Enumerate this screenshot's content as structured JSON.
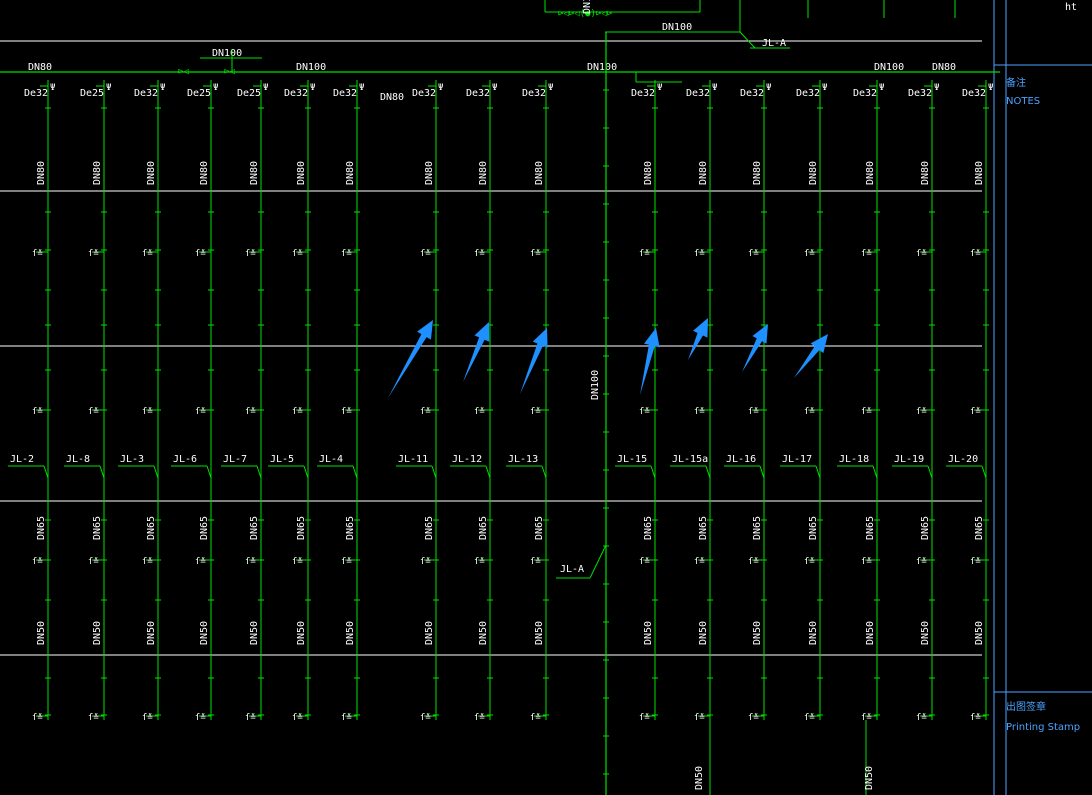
{
  "palette": {
    "background": "#000000",
    "pipe": "#00e000",
    "floor_line": "#ffffff",
    "label": "#ffffff",
    "notes_text": "#4aa3ff",
    "arrow": "#1e90ff"
  },
  "header": {
    "top_right_text": "ht",
    "main_pipe_left_label": "DN80",
    "main_pipe_mid_label": "DN100",
    "main_pipe_riser_label": "DN100",
    "main_pipe_right_labels": [
      "DN100",
      "DN80"
    ],
    "valve_pipe_label": "DN100",
    "top_riser_label": "DN100",
    "top_jl_a_label": "JL-A",
    "dn80_under_label": "DN80"
  },
  "risers": [
    {
      "id": "JL-2",
      "top_size": "De32",
      "mid_size": "DN80",
      "low1": "DN65",
      "low2": "DN50"
    },
    {
      "id": "JL-8",
      "top_size": "De25",
      "mid_size": "DN80",
      "low1": "DN65",
      "low2": "DN50"
    },
    {
      "id": "JL-3",
      "top_size": "De32",
      "mid_size": "DN80",
      "low1": "DN65",
      "low2": "DN50"
    },
    {
      "id": "JL-6",
      "top_size": "De25",
      "mid_size": "DN80",
      "low1": "DN65",
      "low2": "DN50"
    },
    {
      "id": "JL-7",
      "top_size": "De25",
      "mid_size": "DN80",
      "low1": "DN65",
      "low2": "DN50"
    },
    {
      "id": "JL-5",
      "top_size": "De32",
      "mid_size": "DN80",
      "low1": "DN65",
      "low2": "DN50"
    },
    {
      "id": "JL-4",
      "top_size": "De32",
      "mid_size": "DN80",
      "low1": "DN65",
      "low2": "DN50"
    },
    {
      "id": "JL-11",
      "top_size": "De32",
      "mid_size": "DN80",
      "low1": "DN65",
      "low2": "DN50"
    },
    {
      "id": "JL-12",
      "top_size": "De32",
      "mid_size": "DN80",
      "low1": "DN65",
      "low2": "DN50"
    },
    {
      "id": "JL-13",
      "top_size": "De32",
      "mid_size": "DN80",
      "low1": "DN65",
      "low2": "DN50"
    },
    {
      "id": "JL-15",
      "top_size": "De32",
      "mid_size": "DN80",
      "low1": "DN65",
      "low2": "DN50"
    },
    {
      "id": "JL-15a",
      "top_size": "De32",
      "mid_size": "DN80",
      "low1": "DN65",
      "low2": "DN50"
    },
    {
      "id": "JL-16",
      "top_size": "De32",
      "mid_size": "DN80",
      "low1": "DN65",
      "low2": "DN50"
    },
    {
      "id": "JL-17",
      "top_size": "De32",
      "mid_size": "DN80",
      "low1": "DN65",
      "low2": "DN50"
    },
    {
      "id": "JL-18",
      "top_size": "De32",
      "mid_size": "DN80",
      "low1": "DN65",
      "low2": "DN50"
    },
    {
      "id": "JL-19",
      "top_size": "De32",
      "mid_size": "DN80",
      "low1": "DN65",
      "low2": "DN50"
    },
    {
      "id": "JL-20",
      "top_size": "De32",
      "mid_size": "DN80",
      "low1": "DN65",
      "low2": "DN50"
    }
  ],
  "main_riser": {
    "label_mid": "DN100",
    "jl_a_label": "JL-A",
    "bottom_labels": [
      "DN50",
      "DN50"
    ]
  },
  "notes_panel": {
    "notes_cn": "备注",
    "notes_en": "NOTES",
    "stamp_cn": "出图签章",
    "stamp_en": "Printing Stamp"
  },
  "annotation_arrow_count": 7
}
